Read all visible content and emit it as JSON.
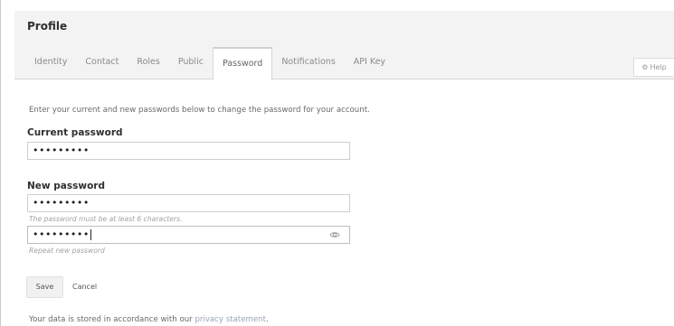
{
  "header": {
    "title": "Profile",
    "tabs": [
      {
        "label": "Identity",
        "active": false
      },
      {
        "label": "Contact",
        "active": false
      },
      {
        "label": "Roles",
        "active": false
      },
      {
        "label": "Public",
        "active": false
      },
      {
        "label": "Password",
        "active": true
      },
      {
        "label": "Notifications",
        "active": false
      },
      {
        "label": "API Key",
        "active": false
      }
    ]
  },
  "help": {
    "label": "Help",
    "icon": "gear-icon"
  },
  "form": {
    "intro": "Enter your current and new passwords below to change the password for your account.",
    "current_password": {
      "label": "Current password",
      "value": "•••••••••"
    },
    "new_password": {
      "label": "New password",
      "value": "•••••••••",
      "hint": "The password must be at least 6 characters."
    },
    "repeat_password": {
      "value": "•••••••••",
      "hint": "Repeat new password",
      "icon": "eye-icon"
    },
    "save_label": "Save",
    "cancel_label": "Cancel"
  },
  "footer": {
    "text": "Your data is stored in accordance with our ",
    "link": "privacy statement",
    "suffix": "."
  },
  "colors": {
    "header_bg": "#f3f3f3",
    "link": "#9aa4b4",
    "text": "#333333"
  }
}
